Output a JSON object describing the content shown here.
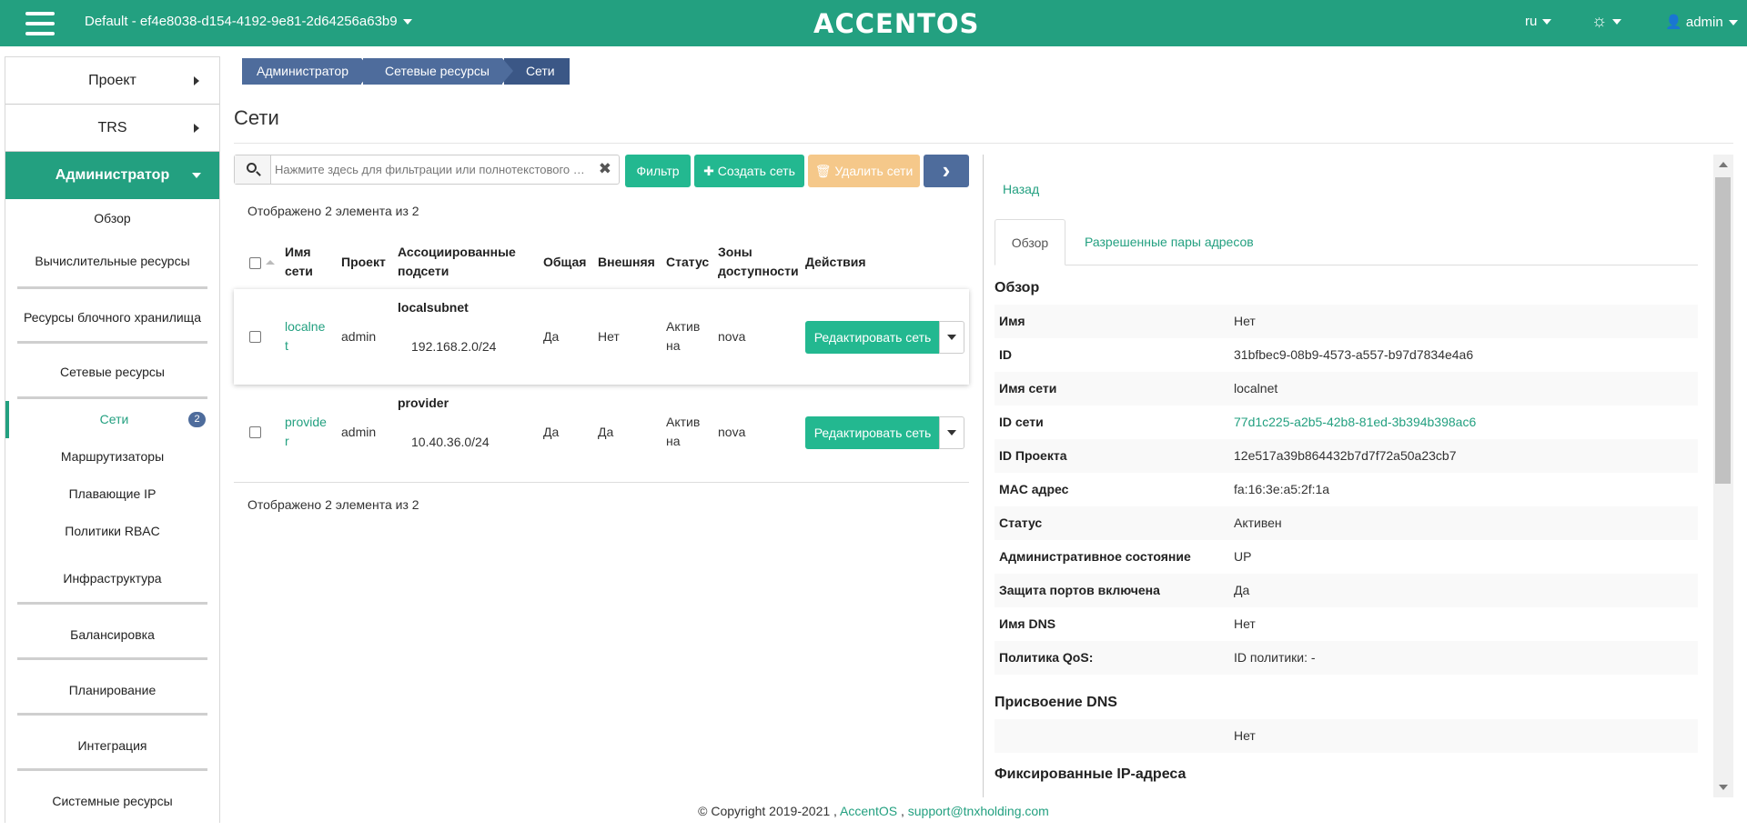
{
  "topbar": {
    "project": "Default - ef4e8038-d154-4192-9e81-2d64256a63b9",
    "logo": "ACCENTOS",
    "language": "ru",
    "user": "admin"
  },
  "sidebar": {
    "top_items": [
      "Проект",
      "TRS"
    ],
    "admin": "Администратор",
    "subs": [
      "Обзор",
      "Вычислительные ресурсы",
      "Ресурсы блочного хранилища",
      "Сетевые ресурсы"
    ],
    "network_items": [
      {
        "label": "Сети",
        "badge": "2"
      },
      {
        "label": "Маршрутизаторы"
      },
      {
        "label": "Плавающие IP"
      },
      {
        "label": "Политики RBAC"
      }
    ],
    "groups": [
      "Инфраструктура",
      "Балансировка",
      "Планирование",
      "Интеграция",
      "Системные ресурсы"
    ]
  },
  "breadcrumb": [
    "Администратор",
    "Сетевые ресурсы",
    "Сети"
  ],
  "page_title": "Сети",
  "toolbar": {
    "search_placeholder": "Нажмите здесь для фильтрации или полнотекстового …",
    "filter": "Фильтр",
    "create": "Создать сеть",
    "delete": "Удалить сети"
  },
  "table": {
    "count_text": "Отображено 2 элемента из 2",
    "headers": {
      "name": [
        "Имя",
        "сети"
      ],
      "project": "Проект",
      "subnets": [
        "Ассоциированные",
        "подсети"
      ],
      "shared": "Общая",
      "external": "Внешняя",
      "status": "Статус",
      "zones": [
        "Зоны",
        "доступности"
      ],
      "actions": "Действия"
    },
    "rows": [
      {
        "name": [
          "localne",
          "t"
        ],
        "project": "admin",
        "subnet_name": "localsubnet",
        "subnet_cidr": "192.168.2.0/24",
        "shared": "Да",
        "external": "Нет",
        "status": [
          "Актив",
          "на"
        ],
        "zone": "nova",
        "action": "Редактировать сеть"
      },
      {
        "name": [
          "provide",
          "r"
        ],
        "project": "admin",
        "subnet_name": "provider",
        "subnet_cidr": "10.40.36.0/24",
        "shared": "Да",
        "external": "Да",
        "status": [
          "Актив",
          "на"
        ],
        "zone": "nova",
        "action": "Редактировать сеть"
      }
    ]
  },
  "detail": {
    "back": "Назад",
    "tabs": [
      "Обзор",
      "Разрешенные пары адресов"
    ],
    "overview_title": "Обзор",
    "overview": [
      {
        "k": "Имя",
        "v": "Нет"
      },
      {
        "k": "ID",
        "v": "31bfbec9-08b9-4573-a557-b97d7834e4a6"
      },
      {
        "k": "Имя сети",
        "v": "localnet"
      },
      {
        "k": "ID сети",
        "v": "77d1c225-a2b5-42b8-81ed-3b394b398ac6"
      },
      {
        "k": "ID Проекта",
        "v": "12e517a39b864432b7d7f72a50a23cb7"
      },
      {
        "k": "MAC адрес",
        "v": "fa:16:3e:a5:2f:1a"
      },
      {
        "k": "Статус",
        "v": "Активен"
      },
      {
        "k": "Административное состояние",
        "v": "UP"
      },
      {
        "k": "Защита портов включена",
        "v": "Да"
      },
      {
        "k": "Имя DNS",
        "v": "Нет"
      },
      {
        "k": "Политика QoS:",
        "v": "ID политики: -"
      }
    ],
    "dns_title": "Присвоение DNS",
    "dns_value": "Нет",
    "fixed_ip_title": "Фиксированные IP-адреса"
  },
  "footer": {
    "copyright": "© Copyright 2019-2021 ,",
    "brand": "AccentOS",
    "sep": ",",
    "email": "support@tnxholding.com"
  },
  "colors": {
    "brand": "#23a080",
    "button": "#23b890",
    "breadcrumb": "#4e6c9c",
    "delete": "#f5c88a"
  }
}
